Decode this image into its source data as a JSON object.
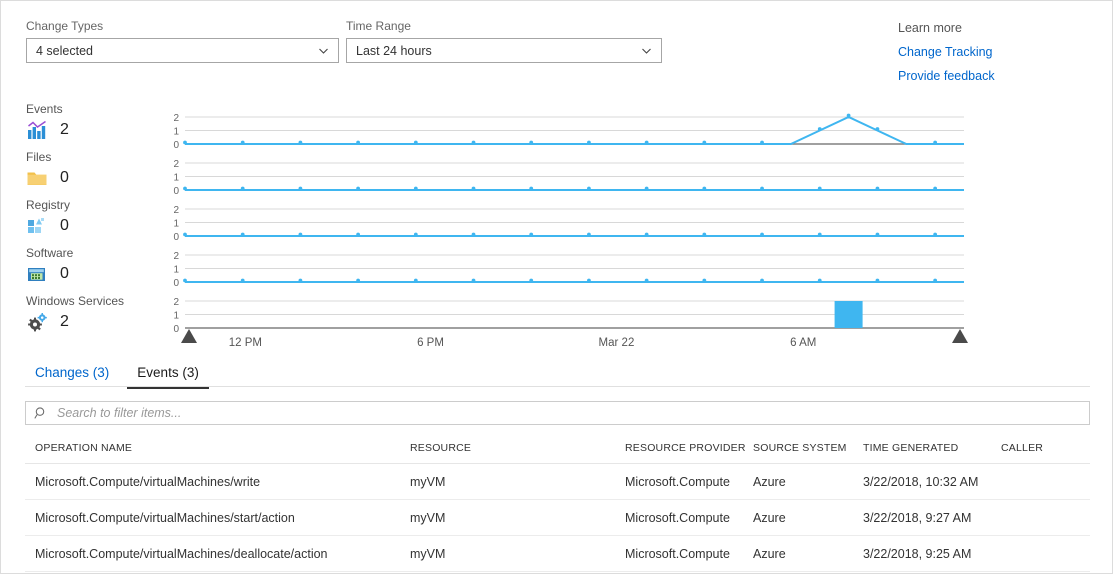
{
  "filters": {
    "change_types": {
      "label": "Change Types",
      "value": "4 selected",
      "icon": "chevron-down-icon"
    },
    "time_range": {
      "label": "Time Range",
      "value": "Last 24 hours",
      "icon": "chevron-down-icon"
    }
  },
  "learn_more": {
    "title": "Learn more",
    "links": [
      {
        "label": "Change Tracking"
      },
      {
        "label": "Provide feedback"
      }
    ],
    "link_color": "#0066cc"
  },
  "summary": [
    {
      "label": "Events",
      "count": "2",
      "icon": "bar-chart-icon"
    },
    {
      "label": "Files",
      "count": "0",
      "icon": "folder-icon"
    },
    {
      "label": "Registry",
      "count": "0",
      "icon": "registry-blocks-icon"
    },
    {
      "label": "Software",
      "count": "0",
      "icon": "software-window-icon"
    },
    {
      "label": "Windows Services",
      "count": "2",
      "icon": "gears-icon"
    }
  ],
  "chart_data": {
    "type": "line",
    "title": "",
    "xlabel": "",
    "ylabel": "",
    "accent_color": "#3fb6f0",
    "grid": true,
    "legend": "none",
    "x_tick_labels": [
      "12 PM",
      "6 PM",
      "Mar 22",
      "6 AM"
    ],
    "x_tick_positions_pct": [
      11.5,
      34.3,
      57.2,
      80.2
    ],
    "ylim": [
      0,
      2
    ],
    "y_ticks": [
      2,
      1,
      0
    ],
    "range_handles": [
      "start-handle",
      "end-handle"
    ],
    "panels": [
      {
        "name": "Events",
        "type": "line",
        "values": [
          0,
          0,
          0,
          0,
          0,
          0,
          0,
          0,
          0,
          0,
          0,
          0,
          0,
          0,
          0,
          0,
          0,
          0,
          0,
          0,
          0,
          0,
          1,
          2,
          1,
          0,
          0,
          0
        ],
        "peak_value": 2,
        "peak_x_pct": 89.5
      },
      {
        "name": "Files",
        "type": "line",
        "values": [
          0,
          0,
          0,
          0,
          0,
          0,
          0,
          0,
          0,
          0,
          0,
          0,
          0,
          0,
          0,
          0,
          0,
          0,
          0,
          0,
          0,
          0,
          0,
          0,
          0,
          0,
          0,
          0
        ]
      },
      {
        "name": "Registry",
        "type": "line",
        "values": [
          0,
          0,
          0,
          0,
          0,
          0,
          0,
          0,
          0,
          0,
          0,
          0,
          0,
          0,
          0,
          0,
          0,
          0,
          0,
          0,
          0,
          0,
          0,
          0,
          0,
          0,
          0,
          0
        ]
      },
      {
        "name": "Software",
        "type": "line",
        "values": [
          0,
          0,
          0,
          0,
          0,
          0,
          0,
          0,
          0,
          0,
          0,
          0,
          0,
          0,
          0,
          0,
          0,
          0,
          0,
          0,
          0,
          0,
          0,
          0,
          0,
          0,
          0,
          0
        ]
      },
      {
        "name": "Windows Services",
        "type": "bar",
        "values": [
          0,
          0,
          0,
          0,
          0,
          0,
          0,
          0,
          0,
          0,
          0,
          0,
          0,
          0,
          0,
          0,
          0,
          0,
          0,
          0,
          0,
          0,
          0,
          2,
          0,
          0,
          0,
          0
        ],
        "bar_value": 2,
        "bar_x_pct": 90.0
      }
    ]
  },
  "tabs": [
    {
      "label": "Changes (3)",
      "active": false
    },
    {
      "label": "Events (3)",
      "active": true
    }
  ],
  "search": {
    "placeholder": "Search to filter items...",
    "value": "",
    "icon": "search-icon"
  },
  "table": {
    "columns": [
      "OPERATION NAME",
      "RESOURCE",
      "RESOURCE PROVIDER",
      "SOURCE SYSTEM",
      "TIME GENERATED",
      "CALLER"
    ],
    "rows": [
      {
        "operation_name": "Microsoft.Compute/virtualMachines/write",
        "resource": "myVM",
        "resource_provider": "Microsoft.Compute",
        "source_system": "Azure",
        "time_generated": "3/22/2018, 10:32 AM",
        "caller": ""
      },
      {
        "operation_name": "Microsoft.Compute/virtualMachines/start/action",
        "resource": "myVM",
        "resource_provider": "Microsoft.Compute",
        "source_system": "Azure",
        "time_generated": "3/22/2018, 9:27 AM",
        "caller": ""
      },
      {
        "operation_name": "Microsoft.Compute/virtualMachines/deallocate/action",
        "resource": "myVM",
        "resource_provider": "Microsoft.Compute",
        "source_system": "Azure",
        "time_generated": "3/22/2018, 9:25 AM",
        "caller": ""
      }
    ]
  }
}
